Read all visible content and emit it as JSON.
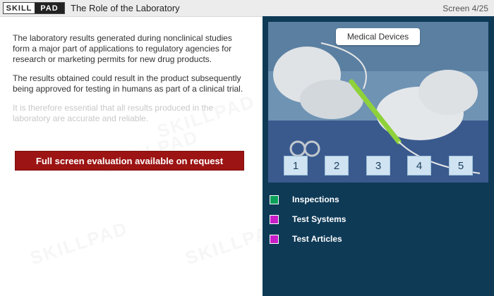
{
  "header": {
    "logo_left": "SKILL",
    "logo_right": "PAD",
    "title": "The Role of the Laboratory",
    "screen_counter": "Screen 4/25"
  },
  "main": {
    "paragraphs": [
      "The laboratory results generated during nonclinical studies form a major part of applications to regulatory agencies for research or marketing permits for new drug products.",
      "The results obtained could result in the product subsequently being approved for testing in humans as part of a clinical trial.",
      "It is therefore essential that all results produced in the laboratory are accurate and reliable."
    ],
    "evaluation_button": "Full screen evaluation available on request"
  },
  "media": {
    "label": "Medical Devices",
    "numbers": [
      "1",
      "2",
      "3",
      "4",
      "5"
    ]
  },
  "legend": [
    {
      "label": "Inspections",
      "color": "#0aa05a"
    },
    {
      "label": "Test Systems",
      "color": "#c81ec8"
    },
    {
      "label": "Test Articles",
      "color": "#c81ec8"
    }
  ],
  "colors": {
    "right_panel": "#0e3a56",
    "evaluation_button": "#9c1413"
  }
}
